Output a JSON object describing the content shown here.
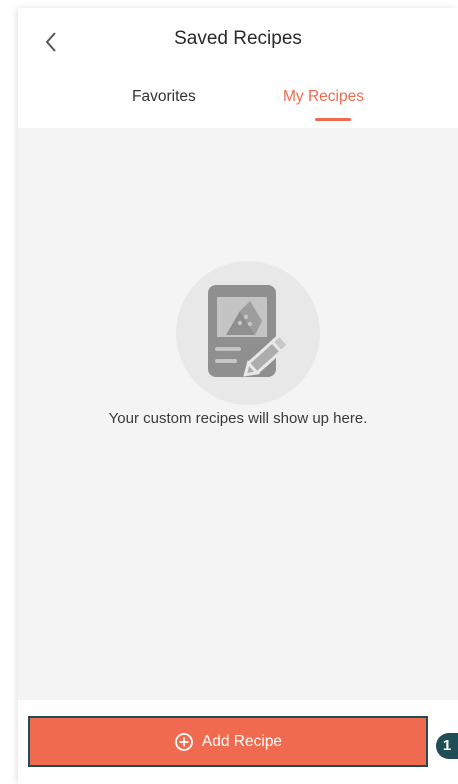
{
  "header": {
    "title": "Saved Recipes"
  },
  "tabs": [
    {
      "label": "Favorites",
      "active": false
    },
    {
      "label": "My Recipes",
      "active": true
    }
  ],
  "empty_state": {
    "icon": "recipe-document-icon",
    "message": "Your custom recipes will show up here."
  },
  "footer": {
    "add_label": "Add Recipe",
    "add_icon": "plus-circle-icon"
  },
  "step_badge": {
    "label": "1"
  },
  "colors": {
    "accent": "#f06a4f",
    "badge": "#1f4e57",
    "background": "#f4f4f4"
  }
}
